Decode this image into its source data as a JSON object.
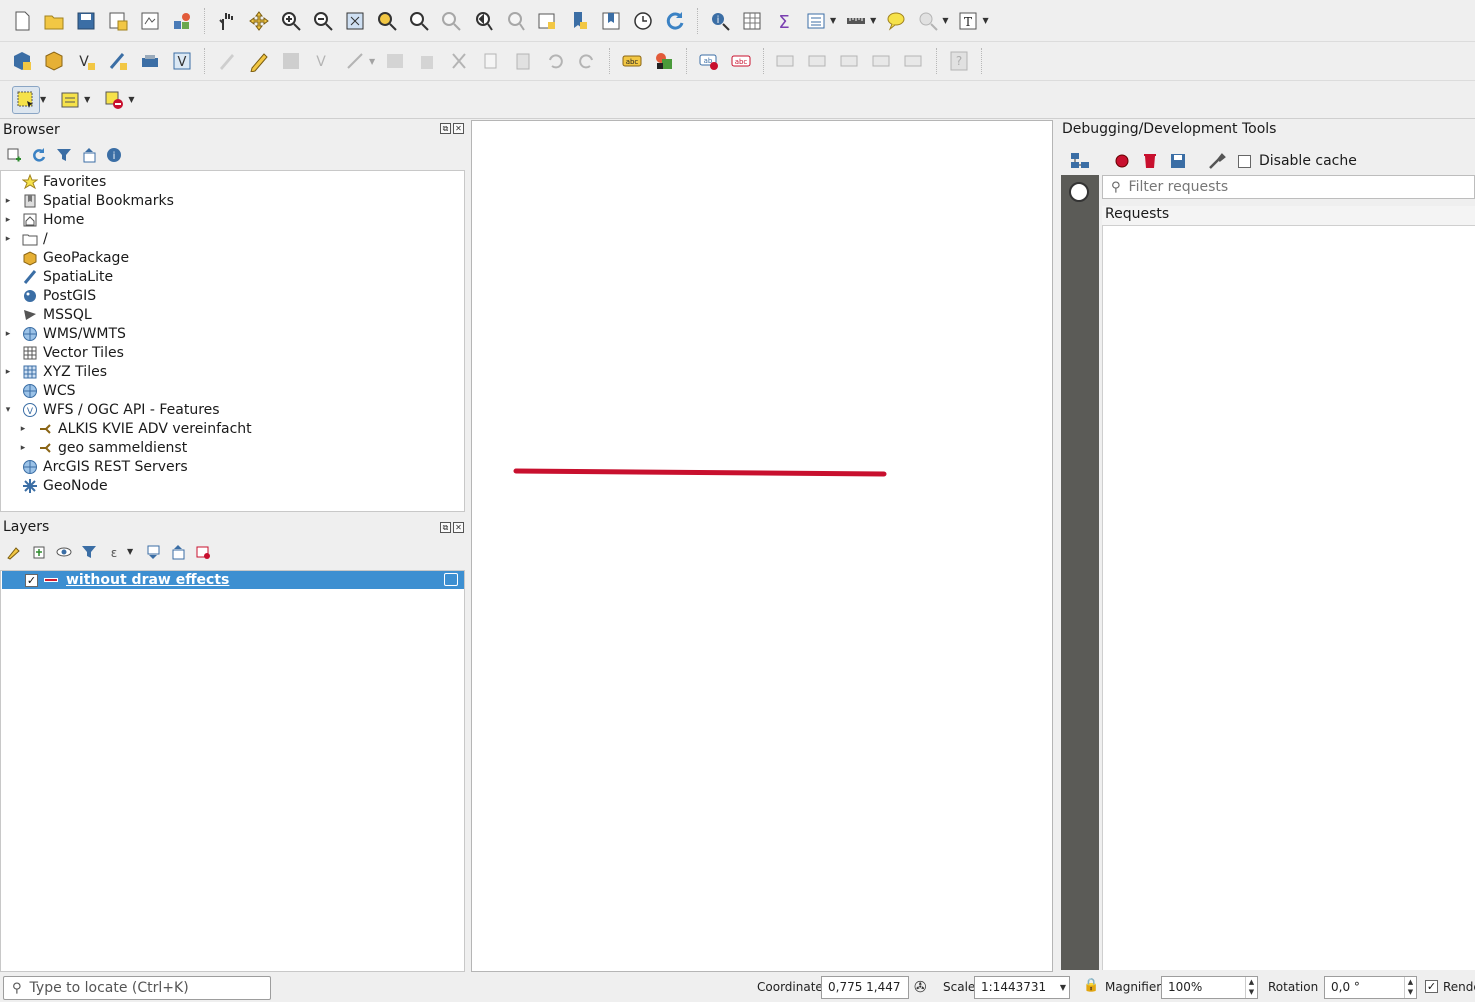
{
  "toolbars": {
    "row1": [
      "new-project",
      "open-project",
      "save-project",
      "save-as",
      "print-layout",
      "style-manager",
      "pan",
      "pan-to-selection",
      "zoom-in",
      "zoom-out",
      "zoom-full",
      "zoom-to-selection",
      "zoom-to-layer",
      "zoom-native",
      "zoom-last",
      "zoom-next",
      "new-map-view",
      "new-bookmark",
      "show-bookmarks",
      "temporal-controller",
      "refresh",
      "identify",
      "attribute-table",
      "statistics",
      "open-field-calculator",
      "measure",
      "map-tips",
      "select-features",
      "text-annotation"
    ],
    "row2": [
      "data-source-manager",
      "new-geopackage-layer",
      "new-virtual-layer",
      "new-spatialite",
      "new-temp-scratch",
      "virtual-layer",
      "edits",
      "toggle-editing",
      "save-edits",
      "add-feature",
      "vertex-tool",
      "modify-attributes",
      "delete-selected",
      "cut",
      "copy",
      "paste",
      "undo",
      "redo",
      "label-layer",
      "diagram",
      "highlight-pinned",
      "show-hide-labels",
      "pin-labels",
      "show-labels",
      "move-labels",
      "rotate-labels",
      "change-label",
      "help"
    ],
    "row3": [
      "select-features-by-area",
      "select-by-value",
      "deselect"
    ]
  },
  "browser": {
    "title": "Browser",
    "items": [
      {
        "label": "Favorites",
        "icon": "star-icon",
        "expand": ""
      },
      {
        "label": "Spatial Bookmarks",
        "icon": "bookmark-icon",
        "expand": "▸"
      },
      {
        "label": "Home",
        "icon": "home-icon",
        "expand": "▸"
      },
      {
        "label": "/",
        "icon": "folder-icon",
        "expand": "▸"
      },
      {
        "label": "GeoPackage",
        "icon": "geopackage-icon",
        "expand": ""
      },
      {
        "label": "SpatiaLite",
        "icon": "spatialite-icon",
        "expand": ""
      },
      {
        "label": "PostGIS",
        "icon": "postgis-icon",
        "expand": ""
      },
      {
        "label": "MSSQL",
        "icon": "mssql-icon",
        "expand": ""
      },
      {
        "label": "WMS/WMTS",
        "icon": "globe-icon",
        "expand": "▸"
      },
      {
        "label": "Vector Tiles",
        "icon": "vector-tiles-icon",
        "expand": ""
      },
      {
        "label": "XYZ Tiles",
        "icon": "xyz-tiles-icon",
        "expand": "▸"
      },
      {
        "label": "WCS",
        "icon": "globe-icon",
        "expand": ""
      },
      {
        "label": "WFS / OGC API - Features",
        "icon": "wfs-icon",
        "expand": "▾"
      },
      {
        "label": "ALKIS KVIE ADV vereinfacht",
        "icon": "connection-icon",
        "expand": "▸",
        "child": true
      },
      {
        "label": "geo sammeldienst",
        "icon": "connection-icon",
        "expand": "▸",
        "child": true
      },
      {
        "label": "ArcGIS REST Servers",
        "icon": "globe-icon",
        "expand": ""
      },
      {
        "label": "GeoNode",
        "icon": "geonode-icon",
        "expand": ""
      }
    ]
  },
  "layers": {
    "title": "Layers",
    "items": [
      {
        "label": "without draw effects",
        "checked": "✓",
        "color": "#d01c2f"
      }
    ]
  },
  "map": {
    "line_color": "#c8102e"
  },
  "debug": {
    "title": "Debugging/Development Tools",
    "disable_cache_label": "Disable cache",
    "filter_placeholder": "Filter requests",
    "requests_header": "Requests"
  },
  "status": {
    "locator_placeholder": "Type to locate (Ctrl+K)",
    "coordinate_label": "Coordinate",
    "coordinate_value": "0,775 1,447",
    "scale_label": "Scale",
    "scale_value": "1:1443731",
    "magnifier_label": "Magnifier",
    "magnifier_value": "100%",
    "rotation_label": "Rotation",
    "rotation_value": "0,0 °",
    "render_label": "Render",
    "render_checked": "✓"
  }
}
